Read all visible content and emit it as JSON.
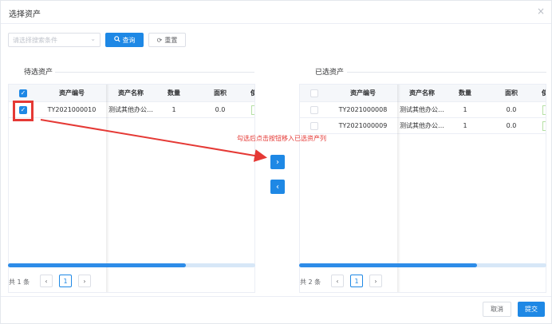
{
  "dialog": {
    "title": "选择资产",
    "close_symbol": "×"
  },
  "search": {
    "placeholder": "请选择搜索条件",
    "query_label": "查询",
    "reset_label": "重置"
  },
  "left": {
    "title": "待选资产",
    "columns": [
      "资产编号",
      "资产名称",
      "数量",
      "面积",
      "使"
    ],
    "rows": [
      {
        "checked": true,
        "code": "TY2021000010",
        "name": "测试其他办公…",
        "qty": "1",
        "area": "0.0"
      }
    ],
    "total_text": "共 1 条",
    "page": "1"
  },
  "right": {
    "title": "已选资产",
    "columns": [
      "资产编号",
      "资产名称",
      "数量",
      "面积",
      "使"
    ],
    "rows": [
      {
        "checked": false,
        "code": "TY2021000008",
        "name": "测试其他办公…",
        "qty": "1",
        "area": "0.0"
      },
      {
        "checked": false,
        "code": "TY2021000009",
        "name": "测试其他办公…",
        "qty": "1",
        "area": "0.0"
      }
    ],
    "total_text": "共 2 条",
    "page": "1"
  },
  "transfer": {
    "to_right": "›",
    "to_left": "‹"
  },
  "annotation": {
    "text": "勾选后点击按钮移入已选资产列"
  },
  "footer": {
    "cancel_label": "取消",
    "submit_label": "提交"
  },
  "colors": {
    "primary": "#1e88e5",
    "annotation_red": "#e53935"
  },
  "scroll": {
    "left_visible_fraction": 0.72,
    "right_visible_fraction": 0.72
  }
}
